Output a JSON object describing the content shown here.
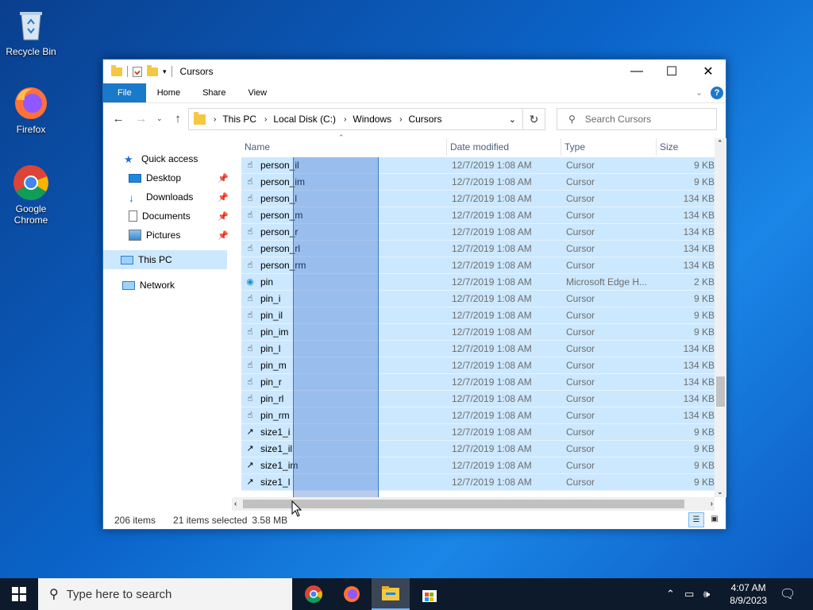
{
  "desktop": {
    "icons": [
      {
        "label": "Recycle Bin"
      },
      {
        "label": "Firefox"
      },
      {
        "label": "Google Chrome"
      }
    ]
  },
  "window": {
    "title": "Cursors",
    "controls": {
      "minimize": "—",
      "maximize": "☐",
      "close": "✕"
    }
  },
  "ribbon": {
    "tabs": [
      "File",
      "Home",
      "Share",
      "View"
    ]
  },
  "address": {
    "crumbs": [
      "This PC",
      "Local Disk (C:)",
      "Windows",
      "Cursors"
    ]
  },
  "search": {
    "placeholder": "Search Cursors"
  },
  "nav": {
    "quick_access": "Quick access",
    "items": [
      "Desktop",
      "Downloads",
      "Documents",
      "Pictures"
    ],
    "this_pc": "This PC",
    "network": "Network"
  },
  "columns": {
    "name": "Name",
    "date": "Date modified",
    "type": "Type",
    "size": "Size"
  },
  "files": [
    {
      "name": "person_il",
      "date": "12/7/2019 1:08 AM",
      "type": "Cursor",
      "size": "9 KB"
    },
    {
      "name": "person_im",
      "date": "12/7/2019 1:08 AM",
      "type": "Cursor",
      "size": "9 KB"
    },
    {
      "name": "person_l",
      "date": "12/7/2019 1:08 AM",
      "type": "Cursor",
      "size": "134 KB"
    },
    {
      "name": "person_m",
      "date": "12/7/2019 1:08 AM",
      "type": "Cursor",
      "size": "134 KB"
    },
    {
      "name": "person_r",
      "date": "12/7/2019 1:08 AM",
      "type": "Cursor",
      "size": "134 KB"
    },
    {
      "name": "person_rl",
      "date": "12/7/2019 1:08 AM",
      "type": "Cursor",
      "size": "134 KB"
    },
    {
      "name": "person_rm",
      "date": "12/7/2019 1:08 AM",
      "type": "Cursor",
      "size": "134 KB"
    },
    {
      "name": "pin",
      "date": "12/7/2019 1:08 AM",
      "type": "Microsoft Edge H...",
      "size": "2 KB"
    },
    {
      "name": "pin_i",
      "date": "12/7/2019 1:08 AM",
      "type": "Cursor",
      "size": "9 KB"
    },
    {
      "name": "pin_il",
      "date": "12/7/2019 1:08 AM",
      "type": "Cursor",
      "size": "9 KB"
    },
    {
      "name": "pin_im",
      "date": "12/7/2019 1:08 AM",
      "type": "Cursor",
      "size": "9 KB"
    },
    {
      "name": "pin_l",
      "date": "12/7/2019 1:08 AM",
      "type": "Cursor",
      "size": "134 KB"
    },
    {
      "name": "pin_m",
      "date": "12/7/2019 1:08 AM",
      "type": "Cursor",
      "size": "134 KB"
    },
    {
      "name": "pin_r",
      "date": "12/7/2019 1:08 AM",
      "type": "Cursor",
      "size": "134 KB"
    },
    {
      "name": "pin_rl",
      "date": "12/7/2019 1:08 AM",
      "type": "Cursor",
      "size": "134 KB"
    },
    {
      "name": "pin_rm",
      "date": "12/7/2019 1:08 AM",
      "type": "Cursor",
      "size": "134 KB"
    },
    {
      "name": "size1_i",
      "date": "12/7/2019 1:08 AM",
      "type": "Cursor",
      "size": "9 KB"
    },
    {
      "name": "size1_il",
      "date": "12/7/2019 1:08 AM",
      "type": "Cursor",
      "size": "9 KB"
    },
    {
      "name": "size1_im",
      "date": "12/7/2019 1:08 AM",
      "type": "Cursor",
      "size": "9 KB"
    },
    {
      "name": "size1_l",
      "date": "12/7/2019 1:08 AM",
      "type": "Cursor",
      "size": "9 KB"
    }
  ],
  "status": {
    "count": "206 items",
    "selected": "21 items selected",
    "size": "3.58 MB"
  },
  "taskbar": {
    "search_placeholder": "Type here to search",
    "time": "4:07 AM",
    "date": "8/9/2023"
  }
}
